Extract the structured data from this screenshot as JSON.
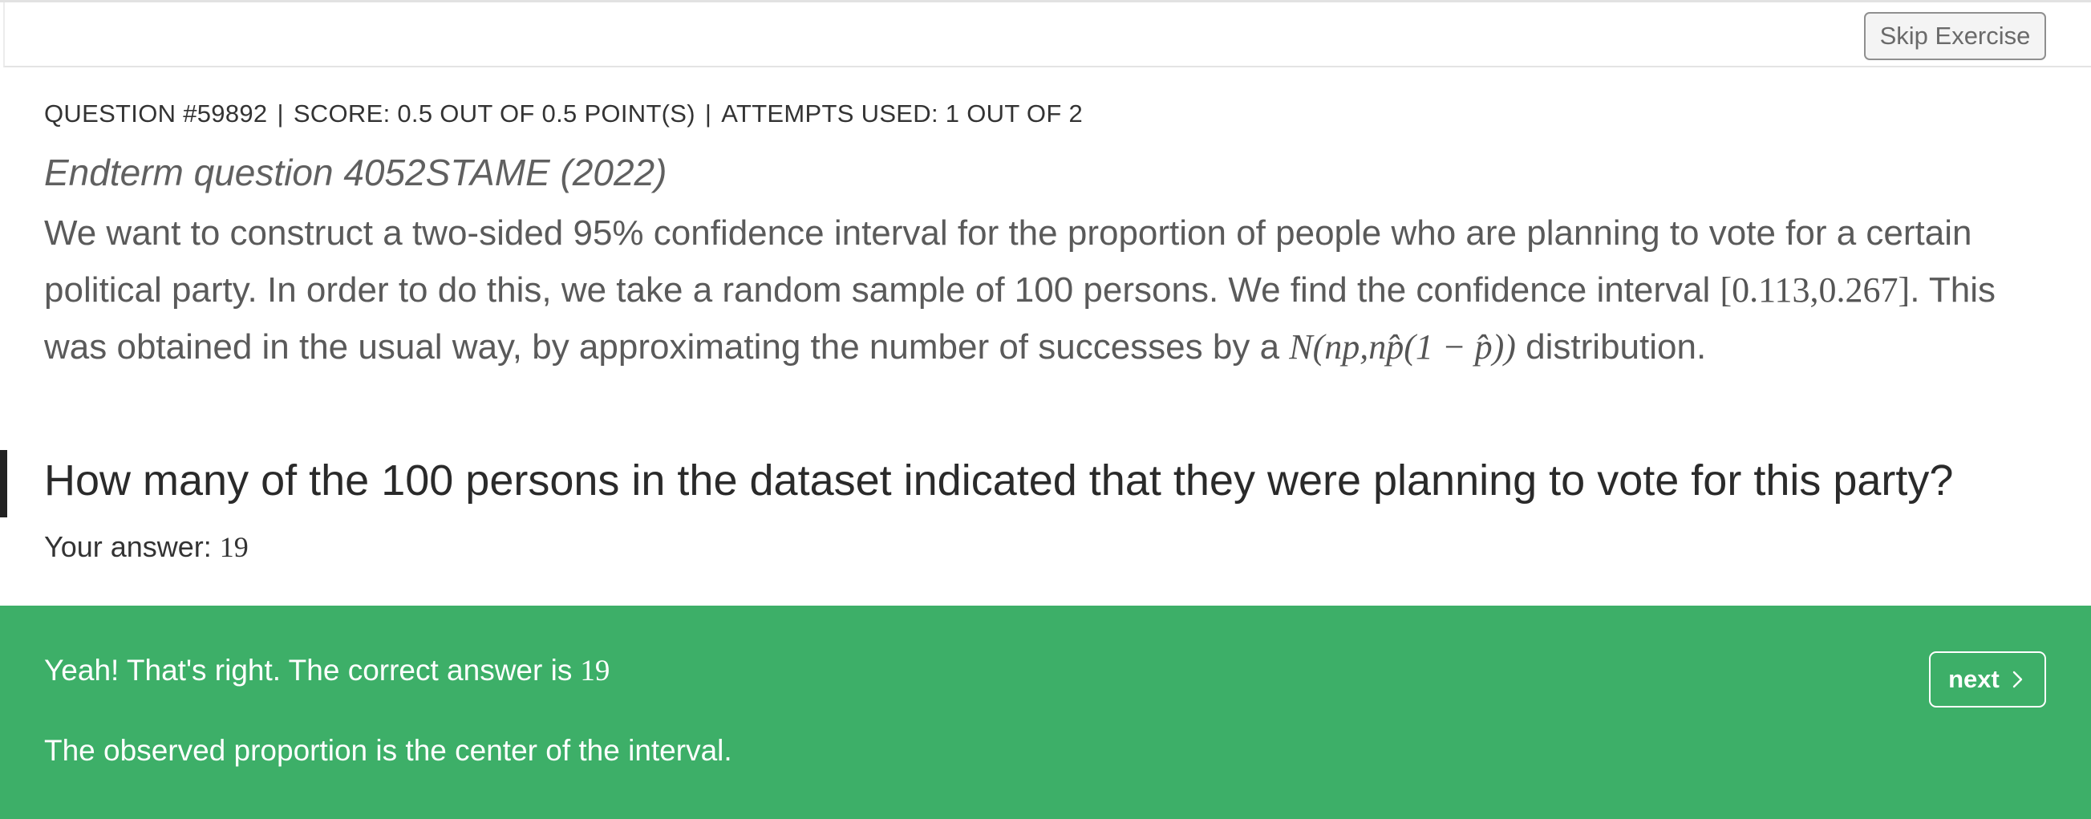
{
  "toolbar": {
    "skip_label": "Skip Exercise"
  },
  "meta": {
    "question": "QUESTION #59892",
    "score": "SCORE: 0.5 OUT OF 0.5 POINT(S)",
    "attempts": "ATTEMPTS USED: 1 OUT OF 2"
  },
  "exercise": {
    "title": "Endterm question 4052STAME (2022)",
    "body_part1": "We want to construct a two-sided 95% confidence interval for the proportion of people who are planning to vote for a certain political party. In order to do this, we take a random sample of 100 persons. We find the confidence interval",
    "interval": "[0.113,0.267]",
    "body_part2": ". This was obtained in the usual way, by approximating the number of successes by a",
    "distribution": "N(np,np̂(1 − p̂))",
    "body_part3": "distribution.",
    "question": "How many of the 100 persons in the dataset indicated that they were planning to vote for this party?"
  },
  "answer": {
    "label": "Your answer:",
    "value": "19"
  },
  "feedback": {
    "status_color": "#3daf68",
    "message": "Yeah! That's right. The correct answer is",
    "correct_value": "19",
    "explanation": "The observed proportion is the center of the interval.",
    "next_label": "next",
    "next_icon": "chevron-right-icon"
  }
}
